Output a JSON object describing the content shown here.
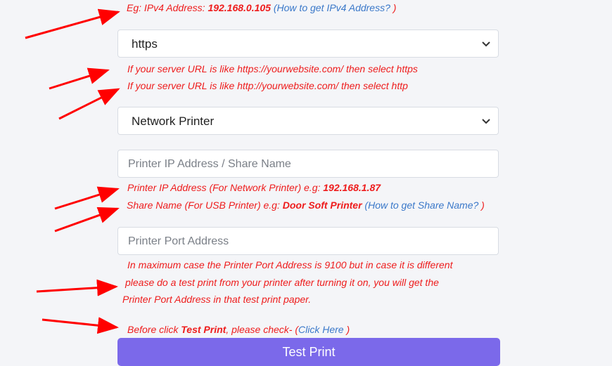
{
  "ipv4_hint": {
    "prefix": "Eg: IPv4 Address: ",
    "value": "192.168.0.105",
    "paren_open": " (",
    "link": "How to get IPv4 Address?",
    "paren_close": " )"
  },
  "protocol_select": {
    "value": "https"
  },
  "protocol_hints": [
    "If your server URL is like https://yourwebsite.com/ then select https",
    "If your server URL is like http://yourwebsite.com/ then select http"
  ],
  "printer_type_select": {
    "value": "Network Printer"
  },
  "printer_ip_input": {
    "placeholder": "Printer IP Address / Share Name"
  },
  "printer_ip_hint": {
    "prefix": "Printer IP Address (For Network Printer) e.g: ",
    "value": "192.168.1.87"
  },
  "share_name_hint": {
    "prefix": "Share Name (For USB Printer) e.g: ",
    "value": "Door Soft Printer",
    "paren_open": " (",
    "link": "How to get Share Name?",
    "paren_close": " )"
  },
  "printer_port_input": {
    "placeholder": "Printer Port Address"
  },
  "port_hints": [
    "In maximum case the Printer Port Address is 9100 but in case it is different",
    "please do a test print from your printer after turning it on, you will get the",
    "Printer Port Address in that test print paper."
  ],
  "test_print_hint": {
    "prefix": "Before click ",
    "bold": "Test Print",
    "middle": ", please check- (",
    "link": "Click Here",
    "suffix": " )"
  },
  "test_print_button": {
    "label": "Test Print"
  },
  "colors": {
    "hint_red": "#ee1c1c",
    "link_blue": "#3a78c9",
    "button_purple": "#7b69ea",
    "arrow_red": "#ff0000"
  }
}
